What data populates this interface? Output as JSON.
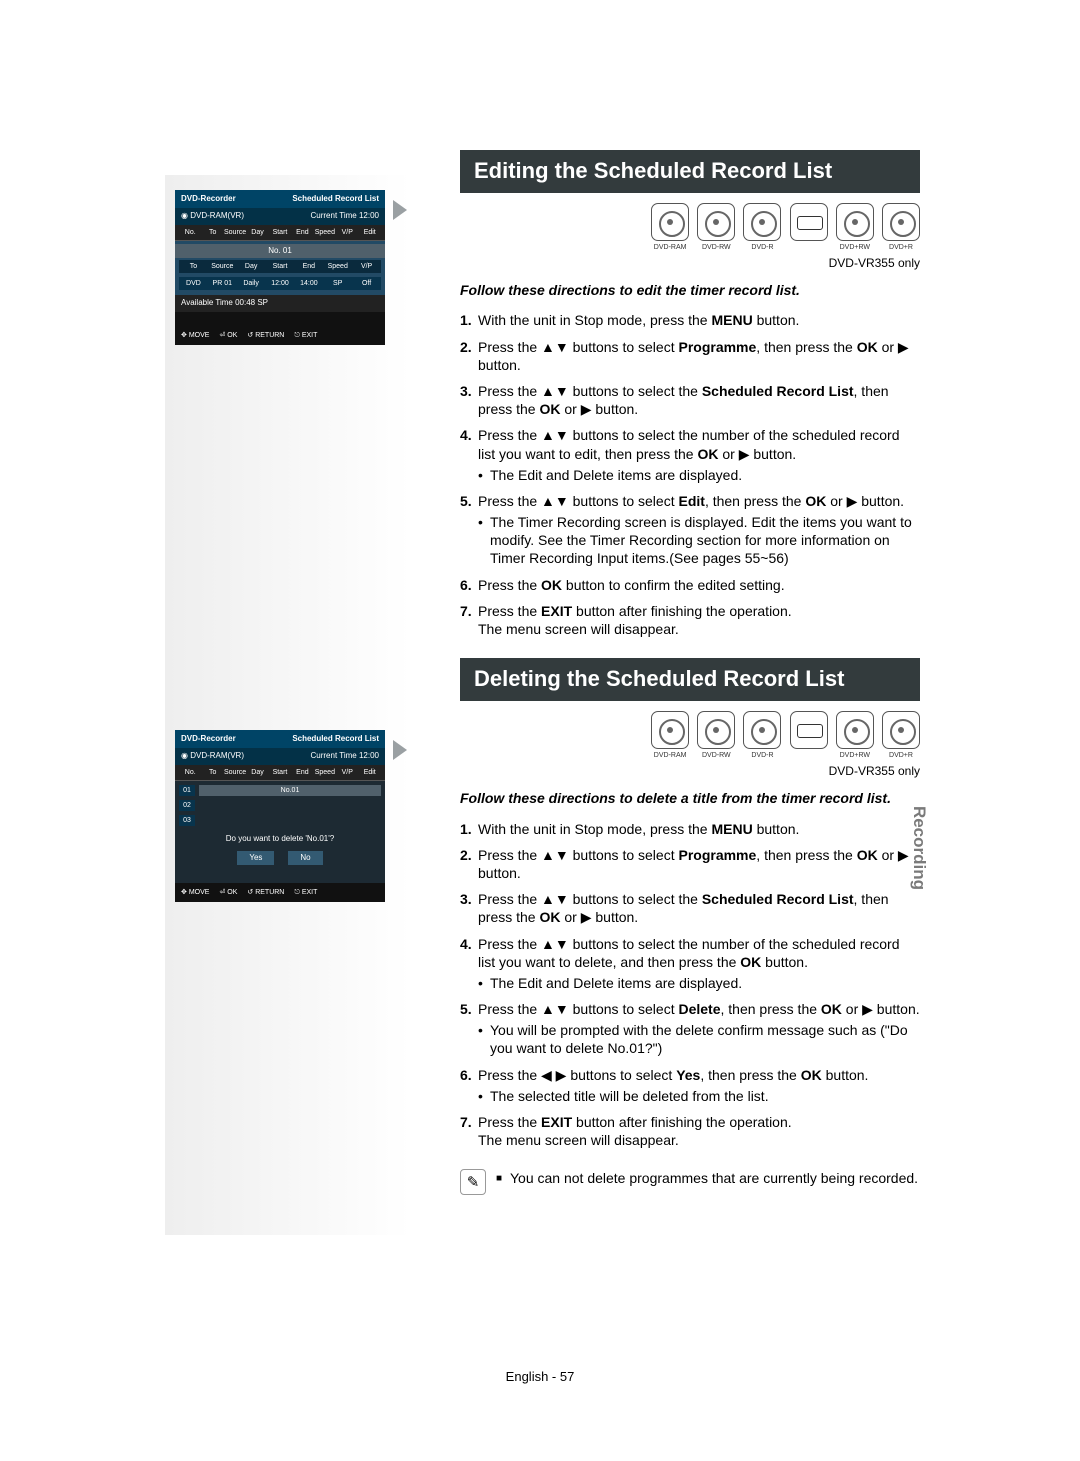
{
  "side_tab": "Recording",
  "model_note": "DVD-VR355 only",
  "disc_labels": [
    "DVD-RAM",
    "DVD-RW",
    "DVD-R",
    "",
    "DVD+RW",
    "DVD+R"
  ],
  "section1": {
    "title": "Editing the Scheduled Record List",
    "lead": "Follow these directions to edit the timer record list.",
    "steps": [
      {
        "pre": "With the unit in Stop mode, press the ",
        "b1": "MENU",
        "post": " button."
      },
      {
        "pre": "Press the ▲▼ buttons to select ",
        "b1": "Programme",
        "mid": ", then press the ",
        "b2": "OK",
        "post": " or ▶ button."
      },
      {
        "pre": "Press the ▲▼ buttons to select the ",
        "b1": "Scheduled Record List",
        "mid": ", then press the ",
        "b2": "OK",
        "post": " or ▶ button."
      },
      {
        "pre": "Press the ▲▼ buttons to select the number of the scheduled record list you want to edit, then press the ",
        "b1": "OK",
        "post": " or ▶ button.",
        "sub": [
          "The Edit and Delete items are displayed."
        ]
      },
      {
        "pre": "Press the ▲▼ buttons to select ",
        "b1": "Edit",
        "mid": ", then press the ",
        "b2": "OK",
        "post": " or ▶ button.",
        "sub": [
          "The Timer Recording screen is displayed. Edit the items you want to modify. See the Timer Recording section for more information on Timer Recording Input items.(See pages 55~56)"
        ]
      },
      {
        "pre": "Press the ",
        "b1": "OK",
        "post": " button to confirm the edited setting."
      },
      {
        "pre": "Press the ",
        "b1": "EXIT",
        "post": " button after finishing the operation.",
        "tail": "The menu screen will disappear."
      }
    ]
  },
  "section2": {
    "title": "Deleting the Scheduled Record List",
    "lead": "Follow these directions to delete a title from the timer record list.",
    "steps": [
      {
        "pre": "With the unit in Stop mode, press the ",
        "b1": "MENU",
        "post": " button."
      },
      {
        "pre": "Press the ▲▼ buttons to select ",
        "b1": "Programme",
        "mid": ", then press the ",
        "b2": "OK",
        "post": " or ▶ button."
      },
      {
        "pre": "Press the ▲▼ buttons to select the ",
        "b1": "Scheduled Record List",
        "mid": ", then press the ",
        "b2": "OK",
        "post": " or ▶ button."
      },
      {
        "pre": "Press the ▲▼ buttons to select the number of the scheduled record list you want to delete, and then press the ",
        "b1": "OK",
        "post": " button.",
        "sub": [
          "The Edit and Delete items are displayed."
        ]
      },
      {
        "pre": "Press the ▲▼ buttons to select ",
        "b1": "Delete",
        "mid": ", then press the ",
        "b2": "OK",
        "post": " or ▶ button.",
        "sub": [
          "You will be prompted with the delete confirm message such as (\"Do you want to delete No.01?\")"
        ]
      },
      {
        "pre": "Press the ◀ ▶ buttons to select ",
        "b1": "Yes",
        "mid": ", then press the ",
        "b2": "OK",
        "post": " button.",
        "sub": [
          "The selected title will be deleted from the list."
        ]
      },
      {
        "pre": "Press the ",
        "b1": "EXIT",
        "post": " button after finishing the operation.",
        "tail": "The menu screen will disappear."
      }
    ],
    "note": "You can not delete programmes that are currently being recorded."
  },
  "osd": {
    "device": "DVD-Recorder",
    "list_title": "Scheduled Record List",
    "media": "DVD-RAM(VR)",
    "time_label": "Current Time",
    "time_value": "12:00",
    "cols": [
      "No.",
      "To",
      "Source",
      "Day",
      "Start",
      "End",
      "Speed",
      "V/P",
      "Edit"
    ],
    "row_label": "No. 01",
    "row_label2": "No.01",
    "editor_heads": [
      "To",
      "Source",
      "Day",
      "Start",
      "End",
      "Speed",
      "V/P"
    ],
    "editor_vals": [
      "DVD",
      "PR 01",
      "Daily",
      "12:00",
      "14:00",
      "SP",
      "Off"
    ],
    "avail": "Available Time  00:48  SP",
    "rows": [
      "01",
      "02",
      "03"
    ],
    "confirm": "Do you want to delete 'No.01'?",
    "yes": "Yes",
    "no": "No",
    "footer": {
      "move": "MOVE",
      "ok": "OK",
      "return": "RETURN",
      "exit": "EXIT"
    }
  },
  "page_footer": "English - 57"
}
